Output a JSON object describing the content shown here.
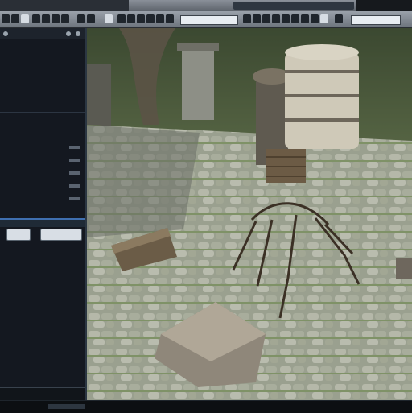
{
  "window": {
    "title": ""
  },
  "left_panel": {
    "rows": [
      {
        "label": "",
        "value": ""
      },
      {
        "label": "",
        "value": ""
      },
      {
        "label": "",
        "value": ""
      },
      {
        "label": "",
        "value": ""
      },
      {
        "label": "",
        "value": ""
      },
      {
        "label": "",
        "value": ""
      },
      {
        "label": "",
        "value": ""
      },
      {
        "label": "",
        "value": ""
      },
      {
        "label": "",
        "value": ""
      },
      {
        "label": "",
        "value": ""
      },
      {
        "label": "",
        "value": ""
      },
      {
        "label": "",
        "value": ""
      },
      {
        "label": "",
        "value": ""
      },
      {
        "label": "",
        "value": ""
      }
    ],
    "sub_rows": [
      {
        "label": ""
      },
      {
        "label": ""
      },
      {
        "label": ""
      },
      {
        "label": ""
      },
      {
        "label": ""
      },
      {
        "label": ""
      },
      {
        "label": ""
      },
      {
        "label": ""
      },
      {
        "label": ""
      },
      {
        "label": ""
      },
      {
        "label": ""
      },
      {
        "label": ""
      }
    ]
  },
  "viewport": {
    "scene": "3d-courtyard-scene",
    "objects": [
      "stone-pavement",
      "wooden-crate",
      "stone-block",
      "branch-creature",
      "barrel-tower",
      "tree-trunk"
    ]
  },
  "colors": {
    "accent": "#3f6fb0",
    "panel_bg": "#141820",
    "toolbar_bg": "#8a9099"
  },
  "icons": [
    "close-icon",
    "minimize-icon",
    "maximize-icon",
    "play-icon",
    "pause-icon",
    "gear-icon",
    "search-icon"
  ]
}
